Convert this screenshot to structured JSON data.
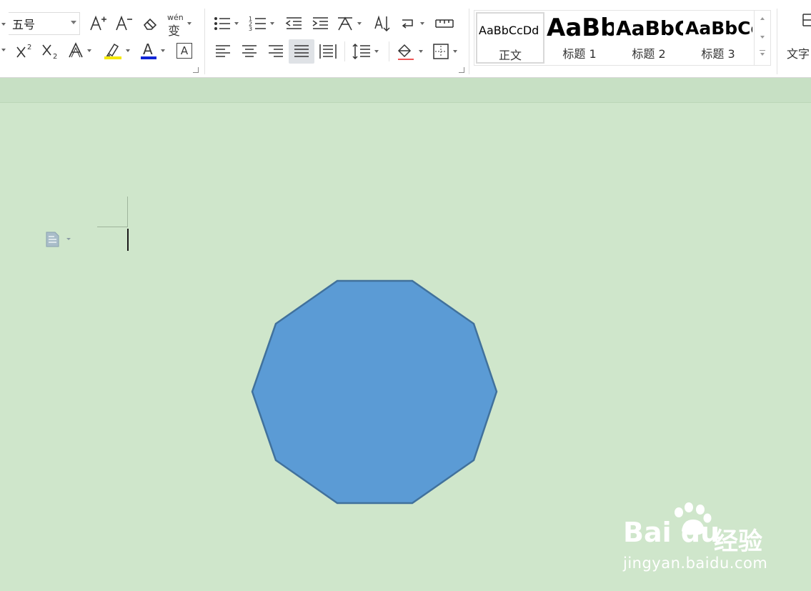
{
  "ribbon": {
    "font_size": "五号",
    "wen_glyph": "wén",
    "wen_char": "变",
    "a_glyph": "A",
    "highlight_color": "#f5e900",
    "font_color": "#1025d6",
    "styles": [
      {
        "preview": "AaBbCcDd",
        "label": "正文"
      },
      {
        "preview": "AaBb",
        "label": "标题 1"
      },
      {
        "preview": "AaBbC",
        "label": "标题 2"
      },
      {
        "preview": "AaBbCc",
        "label": "标题 3"
      }
    ],
    "text_tools_label": "文字"
  },
  "document": {
    "shape": {
      "type": "nonagon",
      "fill": "#5b9bd5",
      "stroke": "#41719c"
    }
  },
  "watermark": {
    "brand": "Bai du",
    "brand_cn": "经验",
    "url": "jingyan.baidu.com"
  },
  "colors": {
    "page_background": "#cfe6cb",
    "ribbon_background": "#ffffff"
  }
}
